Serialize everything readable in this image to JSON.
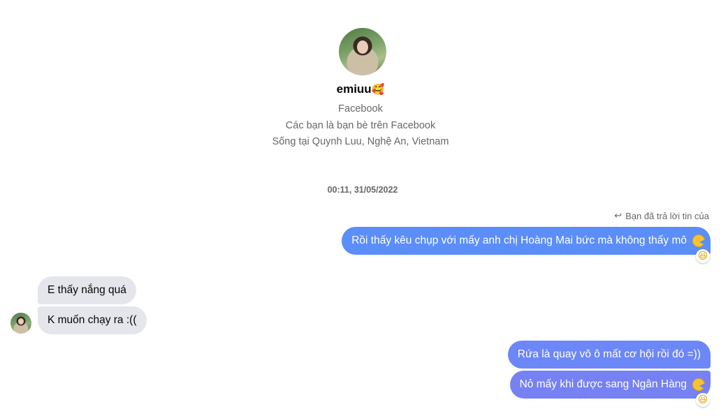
{
  "profile": {
    "name": "emiuu",
    "name_emoji": "🥰",
    "platform": "Facebook",
    "friend_status": "Các bạn là bạn bè trên Facebook",
    "location": "Sống tại Quynh Luu, Nghệ An, Vietnam"
  },
  "conversation": {
    "timestamp": "00:11, 31/05/2022",
    "reply_note": "Bạn đã trả lời tin của",
    "reply_icon": "reply-arrow-icon",
    "messages": [
      {
        "sender": "me",
        "text": "Rồi thấy kêu chụp với mấy anh chị Hoàng Mai bức mà không thấy mô",
        "trailing_emoji": "pacman-emoji-icon",
        "reaction": "😆"
      },
      {
        "sender": "them",
        "text": "E thấy nắng quá"
      },
      {
        "sender": "them",
        "text": "K muốn chạy ra :(("
      },
      {
        "sender": "me",
        "text": "Rứa là quay vô ô mất cơ hội rồi đó =))"
      },
      {
        "sender": "me",
        "text": "Nỏ mấy khi được sang Ngân Hàng",
        "trailing_emoji": "pacman-emoji-icon",
        "reaction": "😆"
      }
    ]
  },
  "colors": {
    "outgoing_bubble_top": "#5b8ef9",
    "outgoing_bubble_mid": "#6c87f7",
    "outgoing_bubble_bottom": "#7681f4",
    "incoming_bubble": "#e4e6eb",
    "secondary_text": "#65676b"
  }
}
